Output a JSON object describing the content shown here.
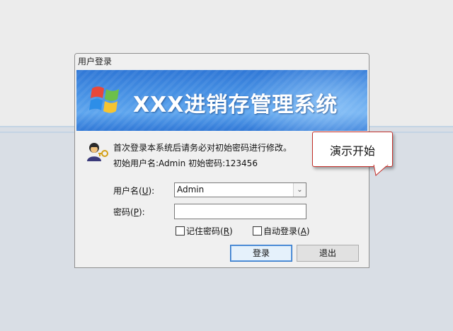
{
  "dialog": {
    "title": "用户登录",
    "banner_title": "XXX进销存管理系统",
    "info_line1": "首次登录本系统后请务必对初始密码进行修改。",
    "info_line2": "初始用户名:Admin 初始密码:123456"
  },
  "form": {
    "username_label": "用户名(",
    "username_key": "U",
    "username_label_end": "):",
    "username_value": "Admin",
    "password_label": "密码(",
    "password_key": "P",
    "password_label_end": "):",
    "password_value": "",
    "remember_label": "记住密码(",
    "remember_key": "R",
    "remember_end": ")",
    "autologin_label": "自动登录(",
    "autologin_key": "A",
    "autologin_end": ")"
  },
  "buttons": {
    "login": "登录",
    "exit": "退出"
  },
  "callout": {
    "text": "演示开始"
  },
  "colors": {
    "banner_blue": "#2f77d6",
    "callout_border": "#c4302b",
    "primary_button_border": "#2f75c7"
  },
  "icons": {
    "logo": "windows-flag-icon",
    "avatar": "user-key-icon",
    "dropdown": "chevron-down-icon"
  }
}
